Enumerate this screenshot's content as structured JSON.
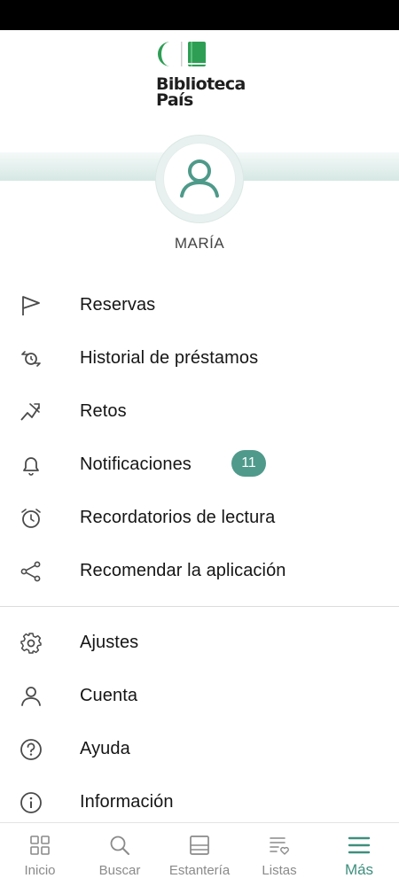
{
  "app": {
    "brand_line1": "Biblioteca",
    "brand_line2": "País"
  },
  "profile": {
    "name": "MARÍA"
  },
  "menu_primary": [
    {
      "label": "Reservas",
      "icon": "flag-icon"
    },
    {
      "label": "Historial de préstamos",
      "icon": "history-icon"
    },
    {
      "label": "Retos",
      "icon": "challenge-icon"
    },
    {
      "label": "Notificaciones",
      "icon": "bell-icon",
      "badge": "11"
    },
    {
      "label": "Recordatorios de lectura",
      "icon": "alarm-clock-icon"
    },
    {
      "label": "Recomendar la aplicación",
      "icon": "share-icon"
    }
  ],
  "menu_secondary": [
    {
      "label": "Ajustes",
      "icon": "gear-icon"
    },
    {
      "label": "Cuenta",
      "icon": "user-icon"
    },
    {
      "label": "Ayuda",
      "icon": "help-icon"
    },
    {
      "label": "Información",
      "icon": "info-icon"
    }
  ],
  "bottom_nav": [
    {
      "label": "Inicio",
      "icon": "grid-icon"
    },
    {
      "label": "Buscar",
      "icon": "search-icon"
    },
    {
      "label": "Estantería",
      "icon": "shelf-icon"
    },
    {
      "label": "Listas",
      "icon": "list-heart-icon"
    },
    {
      "label": "Más",
      "icon": "menu-icon",
      "active": true
    }
  ],
  "colors": {
    "accent": "#3e8f7d",
    "badge": "#4f9a8b",
    "brand_green": "#2e9e55",
    "icon_gray": "#4a4a4a"
  }
}
